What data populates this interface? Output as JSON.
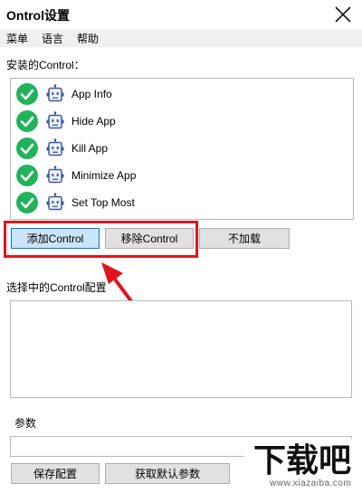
{
  "window": {
    "title": "Ontrol设置"
  },
  "menubar": {
    "items": [
      "菜单",
      "语言",
      "帮助"
    ]
  },
  "installed": {
    "label": "安装的Control：",
    "items": [
      {
        "label": "App Info"
      },
      {
        "label": "Hide App"
      },
      {
        "label": "Kill App"
      },
      {
        "label": "Minimize App"
      },
      {
        "label": "Set Top Most"
      }
    ]
  },
  "actions": {
    "add": "添加Control",
    "remove": "移除Control",
    "unload": "不加载"
  },
  "config": {
    "label": "选择中的Control配置",
    "value": ""
  },
  "params": {
    "label": "参数",
    "value": ""
  },
  "footer": {
    "save": "保存配置",
    "defaults": "获取默认参数"
  },
  "watermark": {
    "logo_text": "下载吧",
    "url": "www.xiazaiba.com"
  },
  "colors": {
    "check_green": "#22b35a",
    "robot_blue": "#3a5a9b",
    "highlight_red": "#e0141e",
    "selected_button": "#cce4f7"
  }
}
